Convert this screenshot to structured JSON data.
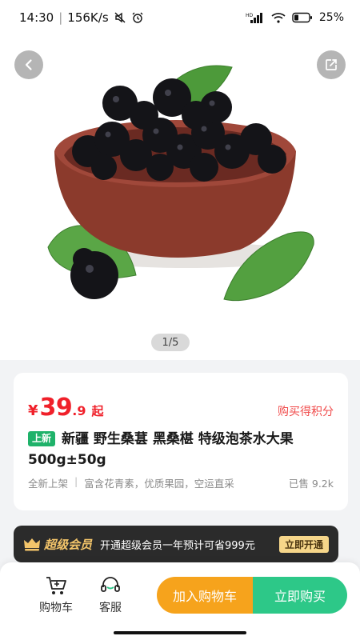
{
  "status_bar": {
    "time": "14:30",
    "net_speed": "156K/s",
    "battery": "25%",
    "network_label": "HD",
    "icons": [
      "mute-icon",
      "alarm-icon",
      "signal-icon",
      "wifi-icon",
      "battery-icon"
    ]
  },
  "hero": {
    "image_subject": "blackberries-in-bowl",
    "pager": "1/5",
    "icons": {
      "back": "chevron-left-icon",
      "share": "share-icon"
    }
  },
  "product": {
    "price_symbol": "¥",
    "price_integer": "39",
    "price_decimal": ".9",
    "price_suffix": "起",
    "points_label": "购买得积分",
    "tag": "上新",
    "title": "新疆 野生桑葚 黑桑椹 特级泡茶水大果500g±50g",
    "meta": {
      "status": "全新上架",
      "desc": "富含花青素，优质果园，空运直采",
      "sold": "已售 9.2k"
    }
  },
  "vip": {
    "title": "超级会员",
    "text": "开通超级会员一年预计可省999元",
    "button": "立即开通"
  },
  "bottom_bar": {
    "cart_label": "购物车",
    "service_label": "客服",
    "add_to_cart": "加入购物车",
    "buy_now": "立即购买"
  },
  "colors": {
    "price_red": "#f0202a",
    "tag_green": "#1fb26a",
    "add_orange": "#f6a31c",
    "buy_green": "#2dc888",
    "vip_gold": "#f4c56a"
  }
}
